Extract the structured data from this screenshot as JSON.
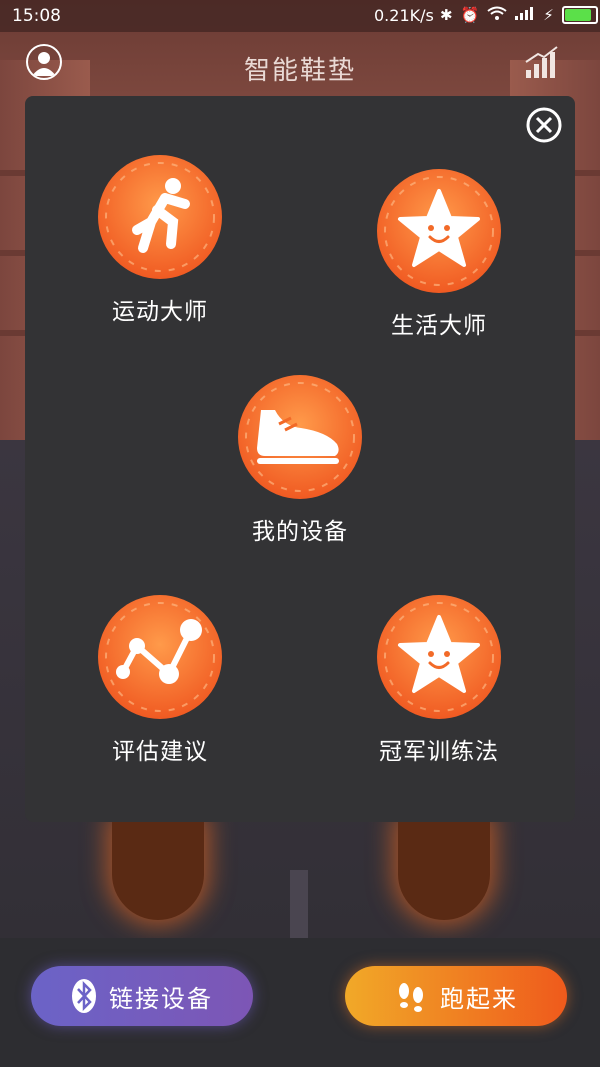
{
  "status_bar": {
    "time": "15:08",
    "network_speed": "0.21K/s"
  },
  "header": {
    "title": "智能鞋垫",
    "avatar_icon": "user-avatar-icon",
    "stats_icon": "bar-chart-icon"
  },
  "menu": {
    "close_icon": "close-icon",
    "items": [
      {
        "label": "运动大师",
        "icon": "runner-icon"
      },
      {
        "label": "生活大师",
        "icon": "smiling-star-icon"
      },
      {
        "label": "我的设备",
        "icon": "sneaker-icon"
      },
      {
        "label": "评估建议",
        "icon": "trend-line-icon"
      },
      {
        "label": "冠军训练法",
        "icon": "smiling-star-icon"
      }
    ]
  },
  "bottom": {
    "connect_label": "链接设备",
    "run_label": "跑起来"
  },
  "colors": {
    "coin_orange": "#f5742a",
    "connect_button": "#6b63c7",
    "run_button": "#ef7a22",
    "battery": "#5be049"
  }
}
